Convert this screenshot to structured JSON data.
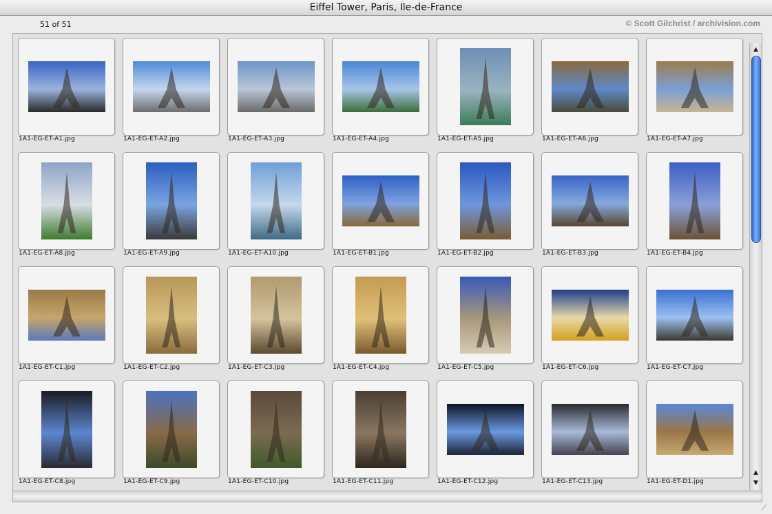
{
  "window": {
    "title": "Eiffel Tower, Paris, Ile-de-France"
  },
  "info": {
    "count": "51 of 51",
    "credit": "© Scott Gilchrist / archivision.com"
  },
  "icons": {
    "scroll_up": "scroll-up-arrow-icon",
    "scroll_down": "scroll-down-arrow-icon",
    "resize": "resize-grip-icon"
  },
  "thumbnails": [
    {
      "file": "1A1-EG-ET-A1.jpg",
      "orient": "landscape",
      "colors": [
        "#3b64c4",
        "#9bb3dd",
        "#2a2a2a"
      ]
    },
    {
      "file": "1A1-EG-ET-A2.jpg",
      "orient": "landscape",
      "colors": [
        "#4f8ad8",
        "#c5d6ee",
        "#6d6d6d"
      ]
    },
    {
      "file": "1A1-EG-ET-A3.jpg",
      "orient": "landscape",
      "colors": [
        "#6e94c8",
        "#b9c6d6",
        "#6a6a6a"
      ]
    },
    {
      "file": "1A1-EG-ET-A4.jpg",
      "orient": "landscape",
      "colors": [
        "#4a86d6",
        "#a8c4e8",
        "#3d6e3a"
      ]
    },
    {
      "file": "1A1-EG-ET-A5.jpg",
      "orient": "portrait",
      "colors": [
        "#6d8fb4",
        "#9ab3c0",
        "#3c7c58"
      ]
    },
    {
      "file": "1A1-EG-ET-A6.jpg",
      "orient": "landscape",
      "colors": [
        "#8a6a40",
        "#5d89c8",
        "#4a4a3a"
      ]
    },
    {
      "file": "1A1-EG-ET-A7.jpg",
      "orient": "landscape",
      "colors": [
        "#9c7c4c",
        "#7aa0d8",
        "#c8b490"
      ]
    },
    {
      "file": "1A1-EG-ET-A8.jpg",
      "orient": "portrait",
      "colors": [
        "#8ea4c8",
        "#d8dde4",
        "#3f7a2e"
      ]
    },
    {
      "file": "1A1-EG-ET-A9.jpg",
      "orient": "portrait",
      "colors": [
        "#2c5ec0",
        "#7aa4e0",
        "#3a3a3a"
      ]
    },
    {
      "file": "1A1-EG-ET-A10.jpg",
      "orient": "portrait",
      "colors": [
        "#6f9ed8",
        "#c5d8ec",
        "#3e6a86"
      ]
    },
    {
      "file": "1A1-EG-ET-B1.jpg",
      "orient": "landscape",
      "colors": [
        "#2f5fc4",
        "#7da2e0",
        "#8a6a3a"
      ]
    },
    {
      "file": "1A1-EG-ET-B2.jpg",
      "orient": "portrait",
      "colors": [
        "#2a58c0",
        "#6f96dc",
        "#7a5c32"
      ]
    },
    {
      "file": "1A1-EG-ET-B3.jpg",
      "orient": "landscape",
      "colors": [
        "#3766c8",
        "#86a8de",
        "#5a4630"
      ]
    },
    {
      "file": "1A1-EG-ET-B4.jpg",
      "orient": "portrait",
      "colors": [
        "#3b5fc4",
        "#8aa0d8",
        "#6b5234"
      ]
    },
    {
      "file": "1A1-EG-ET-C1.jpg",
      "orient": "landscape",
      "colors": [
        "#9c7a48",
        "#c6a56c",
        "#5c7ab8"
      ]
    },
    {
      "file": "1A1-EG-ET-C2.jpg",
      "orient": "portrait",
      "colors": [
        "#b89858",
        "#d8bd80",
        "#8a6c3c"
      ]
    },
    {
      "file": "1A1-EG-ET-C3.jpg",
      "orient": "portrait",
      "colors": [
        "#b09a70",
        "#d4c39c",
        "#5a4a30"
      ]
    },
    {
      "file": "1A1-EG-ET-C4.jpg",
      "orient": "portrait",
      "colors": [
        "#c49a50",
        "#e0c078",
        "#7a5a2e"
      ]
    },
    {
      "file": "1A1-EG-ET-C5.jpg",
      "orient": "portrait",
      "colors": [
        "#3a58b8",
        "#a8987c",
        "#d8cbb4"
      ]
    },
    {
      "file": "1A1-EG-ET-C6.jpg",
      "orient": "landscape",
      "colors": [
        "#1e3e8c",
        "#e8d8a8",
        "#d4a020"
      ]
    },
    {
      "file": "1A1-EG-ET-C7.jpg",
      "orient": "landscape",
      "colors": [
        "#3a70d0",
        "#9cc0f0",
        "#3a3a2e"
      ]
    },
    {
      "file": "1A1-EG-ET-C8.jpg",
      "orient": "portrait",
      "colors": [
        "#1a1a22",
        "#5c86d0",
        "#2a2a30"
      ]
    },
    {
      "file": "1A1-EG-ET-C9.jpg",
      "orient": "portrait",
      "colors": [
        "#4a72c0",
        "#8a6a48",
        "#3a4a2a"
      ]
    },
    {
      "file": "1A1-EG-ET-C10.jpg",
      "orient": "portrait",
      "colors": [
        "#5a4a3a",
        "#7c6a52",
        "#3e5a2a"
      ]
    },
    {
      "file": "1A1-EG-ET-C11.jpg",
      "orient": "portrait",
      "colors": [
        "#4a3e34",
        "#8a7660",
        "#2e2620"
      ]
    },
    {
      "file": "1A1-EG-ET-C12.jpg",
      "orient": "landscape",
      "colors": [
        "#0e1424",
        "#6a9ae0",
        "#1e2436"
      ]
    },
    {
      "file": "1A1-EG-ET-C13.jpg",
      "orient": "landscape",
      "colors": [
        "#2a2a30",
        "#a8b8d8",
        "#44444e"
      ]
    },
    {
      "file": "1A1-EG-ET-D1.jpg",
      "orient": "landscape",
      "colors": [
        "#5a88d8",
        "#9a7648",
        "#c8a870"
      ]
    }
  ]
}
